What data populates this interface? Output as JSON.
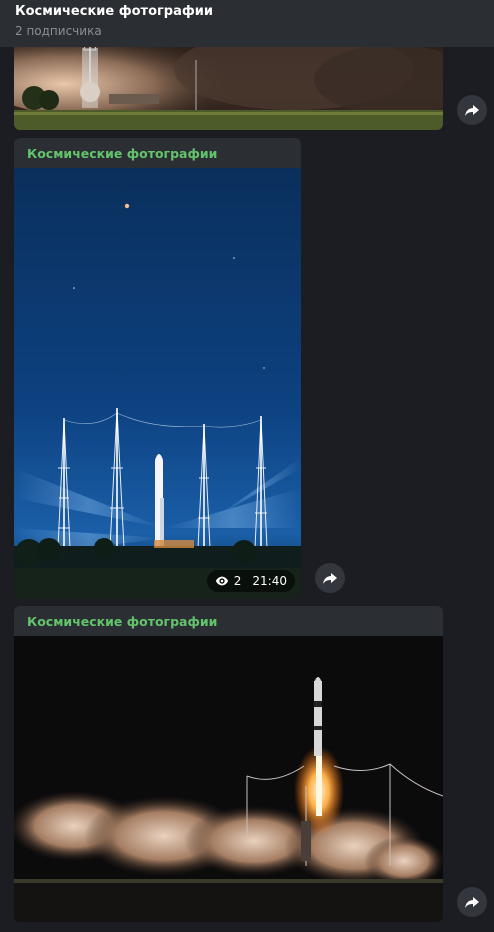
{
  "channel": {
    "title": "Космические фотографии",
    "subscribers": "2 подписчика"
  },
  "messages": [
    {
      "author": ""
    },
    {
      "author": "Космические фотографии",
      "views": "2",
      "time": "21:40"
    },
    {
      "author": "Космические фотографии"
    }
  ],
  "colors": {
    "background": "#1c1d22",
    "bubble": "#2b2e33",
    "author": "#63c46c",
    "header": "#2b2e33"
  },
  "icons": {
    "share": "share-arrow-icon",
    "views": "eye-icon"
  }
}
